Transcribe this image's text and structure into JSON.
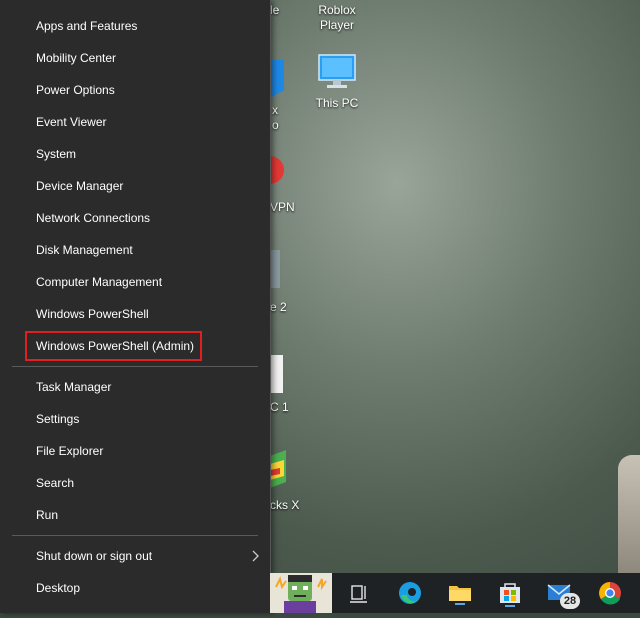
{
  "menu": {
    "items": [
      {
        "label": "Apps and Features"
      },
      {
        "label": "Mobility Center"
      },
      {
        "label": "Power Options"
      },
      {
        "label": "Event Viewer"
      },
      {
        "label": "System"
      },
      {
        "label": "Device Manager"
      },
      {
        "label": "Network Connections"
      },
      {
        "label": "Disk Management"
      },
      {
        "label": "Computer Management"
      },
      {
        "label": "Windows PowerShell"
      },
      {
        "label": "Windows PowerShell (Admin)"
      },
      {
        "label": "Task Manager"
      },
      {
        "label": "Settings"
      },
      {
        "label": "File Explorer"
      },
      {
        "label": "Search"
      },
      {
        "label": "Run"
      },
      {
        "label": "Shut down or sign out"
      },
      {
        "label": "Desktop"
      }
    ]
  },
  "desktop": {
    "icons": [
      {
        "label_line1": "Roblox",
        "label_line2": "Player"
      },
      {
        "label_line1": "This PC"
      }
    ],
    "partial_labels": [
      "le",
      "x",
      "o",
      "VPN",
      "e 2",
      "C 1",
      "cks X"
    ]
  },
  "taskbar": {
    "mail_badge": "28"
  },
  "colors": {
    "highlight": "#e0201e",
    "menu_bg": "#2b2b2b"
  }
}
